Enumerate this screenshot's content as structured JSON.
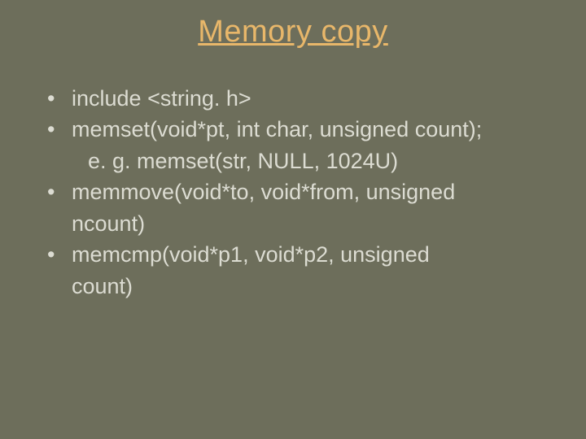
{
  "slide": {
    "title": "Memory copy",
    "items": {
      "b1": "include <string. h>",
      "b2": "memset(void*pt, int char, unsigned count);",
      "b2_sub": "e. g.   memset(str, NULL, 1024U)",
      "b3": "memmove(void*to, void*from, unsigned",
      "b3_cont": "ncount)",
      "b4": "memcmp(void*p1, void*p2, unsigned",
      "b4_cont": "count)"
    }
  }
}
